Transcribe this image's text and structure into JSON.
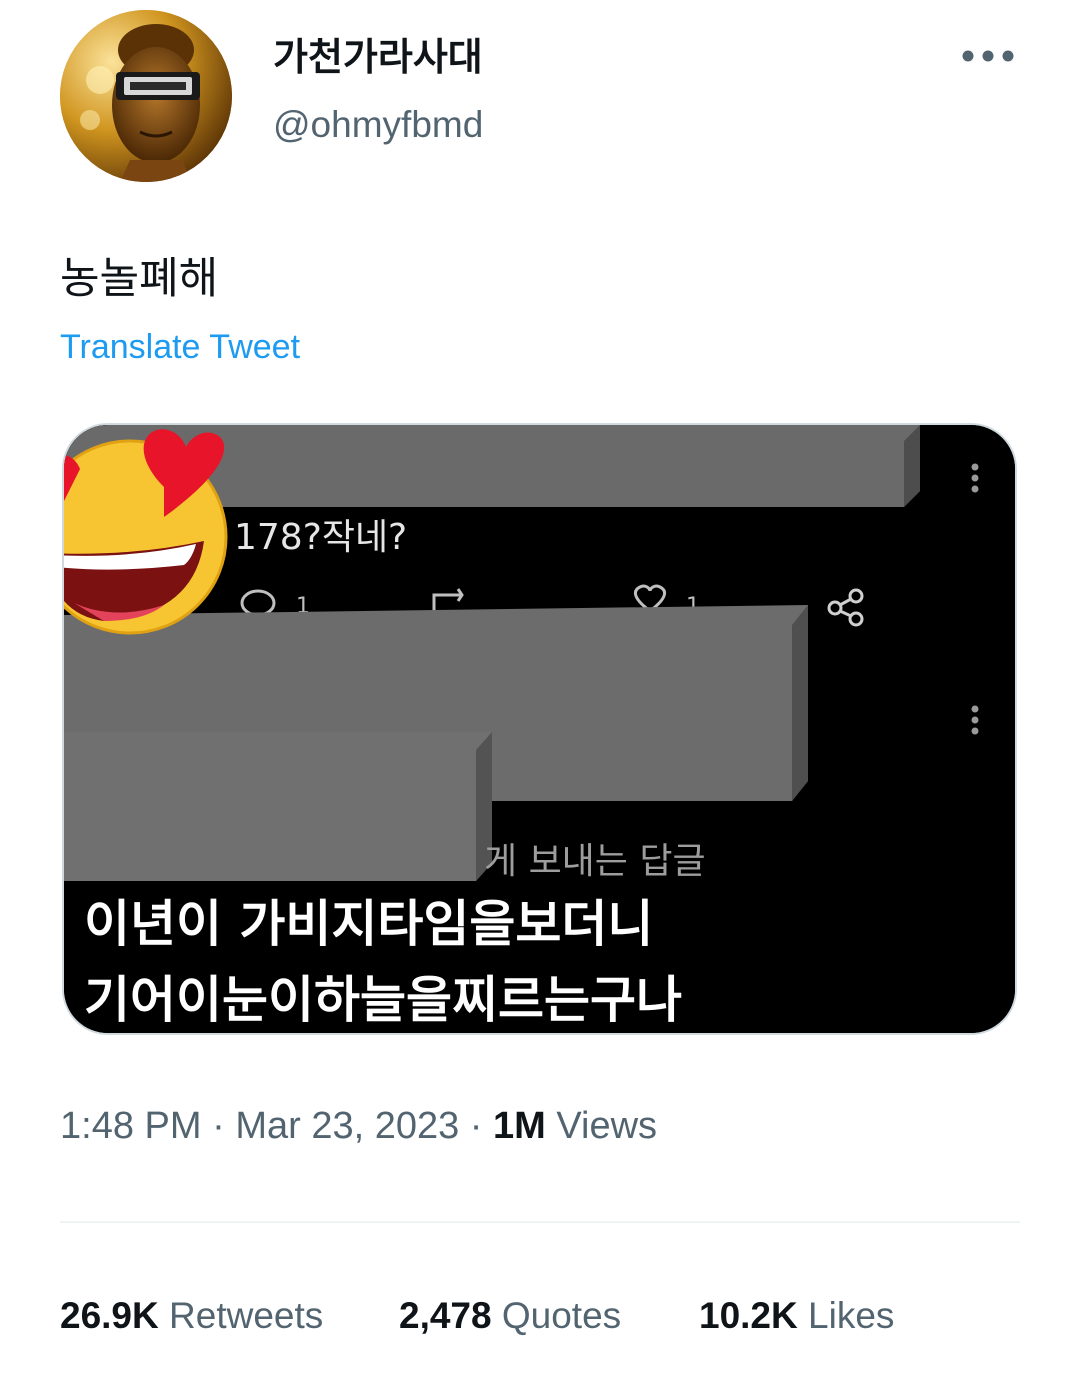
{
  "author": {
    "display_name": "가천가라사대",
    "handle": "@ohmyfbmd"
  },
  "tweet": {
    "text": "농놀폐해",
    "translate_label": "Translate Tweet",
    "time": "1:48 PM",
    "date": "Mar 23, 2023",
    "views_count": "1M",
    "views_label": "Views"
  },
  "media": {
    "comment_text": "178?작네?",
    "reply_count": "1",
    "like_count": "1",
    "partial_caption": "게 보내는 답글",
    "caption_line1": "이년이 가비지타임을보더니",
    "caption_line2": "기어이눈이하늘을찌르는구나"
  },
  "stats": {
    "retweets_count": "26.9K",
    "retweets_label": "Retweets",
    "quotes_count": "2,478",
    "quotes_label": "Quotes",
    "likes_count": "10.2K",
    "likes_label": "Likes"
  },
  "icons": {
    "more": "more-horizontal-icon",
    "share": "share-icon",
    "emoji": "heart-eyes-emoji-icon"
  }
}
